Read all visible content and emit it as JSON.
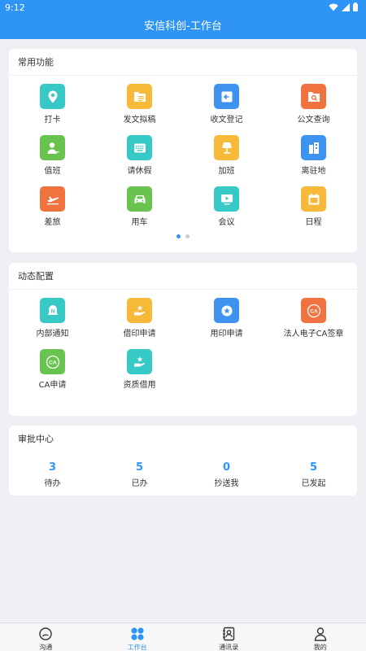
{
  "status": {
    "time": "9:12"
  },
  "app": {
    "title": "安信科创-工作台"
  },
  "common": {
    "title": "常用功能",
    "items": [
      {
        "label": "打卡",
        "icon": "location-pin-icon",
        "color": "#36c9c6"
      },
      {
        "label": "发文拟稿",
        "icon": "folder-doc-icon",
        "color": "#f7b93a"
      },
      {
        "label": "收文登记",
        "icon": "inbox-arrow-icon",
        "color": "#3f93f0"
      },
      {
        "label": "公文查询",
        "icon": "folder-search-icon",
        "color": "#f0733f"
      },
      {
        "label": "值班",
        "icon": "person-duty-icon",
        "color": "#69c44f"
      },
      {
        "label": "请休假",
        "icon": "keyboard-icon",
        "color": "#36c9c6"
      },
      {
        "label": "加班",
        "icon": "desk-lamp-icon",
        "color": "#f7b93a"
      },
      {
        "label": "离驻地",
        "icon": "buildings-icon",
        "color": "#3f93f0"
      },
      {
        "label": "差旅",
        "icon": "airplane-icon",
        "color": "#f0733f"
      },
      {
        "label": "用车",
        "icon": "car-icon",
        "color": "#69c44f"
      },
      {
        "label": "会议",
        "icon": "presentation-icon",
        "color": "#36c9c6"
      },
      {
        "label": "日程",
        "icon": "calendar-icon",
        "color": "#f7b93a"
      }
    ]
  },
  "dynamic": {
    "title": "动态配置",
    "items": [
      {
        "label": "内部通知",
        "icon": "notification-bell-icon",
        "color": "#36c9c6"
      },
      {
        "label": "借印申请",
        "icon": "hand-seal-icon",
        "color": "#f7b93a"
      },
      {
        "label": "用印申请",
        "icon": "stamp-star-icon",
        "color": "#3f93f0"
      },
      {
        "label": "法人电子CA签章",
        "icon": "ca-badge-icon",
        "color": "#f0733f",
        "badge": "CA"
      },
      {
        "label": "CA申请",
        "icon": "ca-badge-icon",
        "color": "#69c44f",
        "badge": "CA"
      },
      {
        "label": "资质借用",
        "icon": "hand-certificate-icon",
        "color": "#36c9c6"
      }
    ]
  },
  "approval": {
    "title": "审批中心",
    "stats": [
      {
        "value": "3",
        "label": "待办"
      },
      {
        "value": "5",
        "label": "已办"
      },
      {
        "value": "0",
        "label": "抄送我"
      },
      {
        "value": "5",
        "label": "已发起"
      }
    ]
  },
  "tabs": [
    {
      "label": "沟通",
      "icon": "chat-bubble-icon",
      "active": false
    },
    {
      "label": "工作台",
      "icon": "workbench-grid-icon",
      "active": true
    },
    {
      "label": "通讯录",
      "icon": "contacts-book-icon",
      "active": false
    },
    {
      "label": "我的",
      "icon": "user-profile-icon",
      "active": false
    }
  ],
  "colors": {
    "primary": "#2e94f5",
    "background": "#eef0f4"
  }
}
